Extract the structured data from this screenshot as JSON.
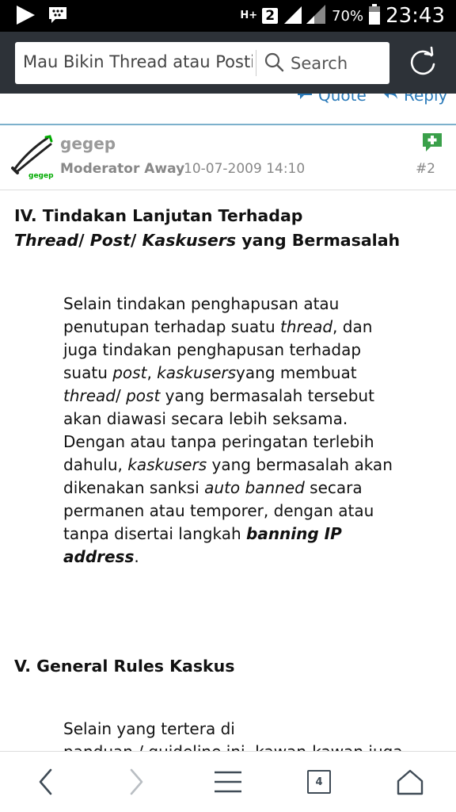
{
  "status_bar": {
    "network_type": "H+",
    "sim_slot": "2",
    "battery": "70%",
    "time": "23:43",
    "icons": [
      "play-icon",
      "bbm-icon",
      "signal-icon",
      "battery-icon"
    ]
  },
  "browser": {
    "url_text": "Mau Bikin Thread atau Posti",
    "search_label": "Search",
    "icons": [
      "search-icon",
      "reload-icon"
    ]
  },
  "prev_post_actions": {
    "quote_label": "Quote",
    "reply_label": "Reply"
  },
  "post": {
    "username": "gegep",
    "avatar_caption": "gegep",
    "user_title": "Moderator Away",
    "date": "10-07-2009 14:10",
    "post_number": "#2"
  },
  "section4": {
    "line1": "IV. Tindakan Lanjutan Terhadap",
    "line2_i1": "Thread",
    "line2_s1": "/ ",
    "line2_i2": "Post",
    "line2_s2": "/ ",
    "line2_i3": "Kaskusers",
    "line2_rest": " yang Bermasalah",
    "p": {
      "t1": "Selain tindakan penghapusan atau penutupan terhadap suatu ",
      "i1": "thread",
      "t2": ", dan juga tindakan penghapusan terhadap suatu ",
      "i2": "post",
      "t3": ", ",
      "i3": "kaskusers",
      "t4": "yang membuat ",
      "i4": "thread",
      "t5": "/ ",
      "i5": "post",
      "t6": " yang bermasalah tersebut akan diawasi secara lebih seksama. Dengan atau tanpa peringatan terlebih dahulu, ",
      "i6": "kaskusers",
      "t7": " yang bermasalah akan dikenakan sanksi ",
      "i7": "auto banned",
      "t8": " secara permanen atau temporer, dengan atau tanpa disertai langkah ",
      "b1": "banning IP address",
      "t9": "."
    }
  },
  "section5": {
    "title": "V. General Rules Kaskus",
    "p_line1": "Selain yang tertera di",
    "p_line2": "panduan / guideline ini, kawan-kawan juga"
  },
  "bottom_nav": {
    "tab_count": "4"
  }
}
